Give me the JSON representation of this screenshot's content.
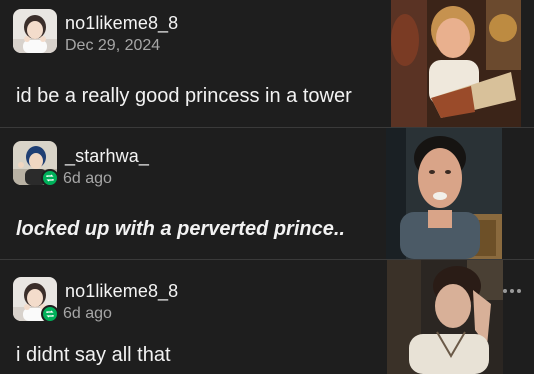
{
  "posts": [
    {
      "username": "no1likeme8_8",
      "meta": "Dec 29, 2024",
      "text": "id be a really good princess in a tower",
      "reblogged": false
    },
    {
      "username": "_starhwa_",
      "meta": "6d ago",
      "text": "locked up with a perverted prince..",
      "reblogged": true
    },
    {
      "username": "no1likeme8_8",
      "meta": "6d ago",
      "text": "i didnt say all that",
      "reblogged": true
    }
  ],
  "icons": {
    "reblog": "reblog-icon",
    "more": "more-options-icon"
  },
  "colors": {
    "background": "#1e1e1e",
    "text": "#f2f2f2",
    "meta": "#a6a6a6",
    "reblog_badge": "#00b05a"
  }
}
